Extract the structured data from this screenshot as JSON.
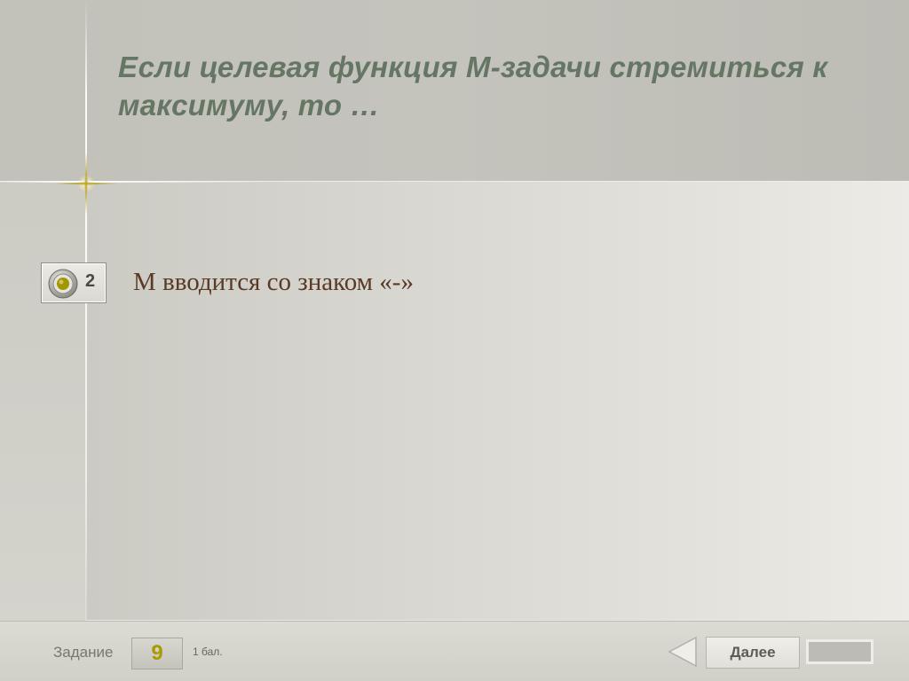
{
  "slide": {
    "title": "Если целевая функция М-задачи стремиться к максимуму, то …",
    "answer": {
      "number": "2",
      "text": "М вводится со знаком «-»"
    }
  },
  "footer": {
    "task_label": "Задание",
    "task_number": "9",
    "points": "1 бал.",
    "next_label": "Далее"
  },
  "colors": {
    "title": "#667664",
    "answer_text": "#5a3a26",
    "task_number": "#a89a00"
  }
}
